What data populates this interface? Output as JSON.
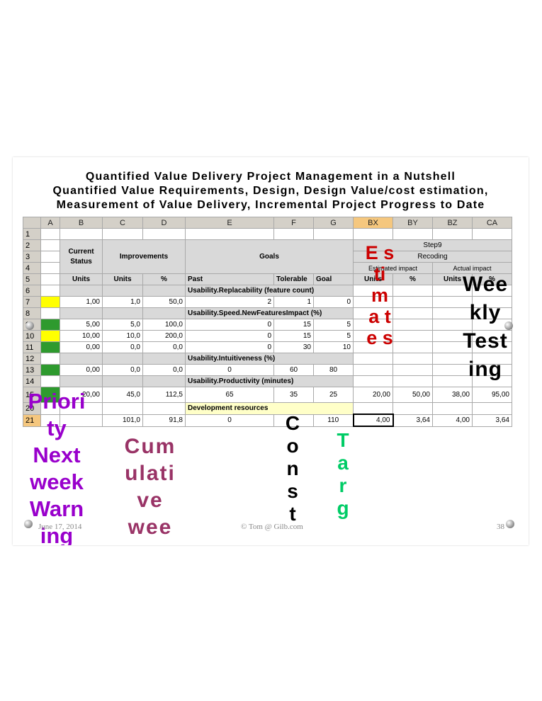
{
  "title": {
    "line1": "Quantified Value Delivery Project Management in a Nutshell",
    "line2": "Quantified Value Requirements, Design, Design Value/cost estimation,",
    "line3": "Measurement of Value Delivery, Incremental Project Progress to Date"
  },
  "sheet": {
    "columns": [
      "",
      "A",
      "B",
      "C",
      "D",
      "E",
      "F",
      "G",
      "BX",
      "BY",
      "BZ",
      "CA"
    ],
    "header_block": {
      "current_status": "Current Status",
      "improvements": "Improvements",
      "goals": "Goals",
      "step": "Step9",
      "recoding": "Recoding",
      "estimated_impact": "Estimated impact",
      "actual_impact": "Actual impact"
    },
    "units_row": [
      "Units",
      "Units",
      "%",
      "Past",
      "Tolerable",
      "Goal",
      "Units",
      "%",
      "Units",
      "%"
    ],
    "rows": [
      {
        "n": "6",
        "label": "Usability.Replacability (feature count)"
      },
      {
        "n": "7",
        "B": "1,00",
        "C": "1,0",
        "D": "50,0",
        "E": "2",
        "F": "1",
        "G": "0"
      },
      {
        "n": "8",
        "label": "Usability.Speed.NewFeaturesImpact (%)"
      },
      {
        "n": "9",
        "B": "5,00",
        "C": "5,0",
        "D": "100,0",
        "E": "0",
        "F": "15",
        "G": "5"
      },
      {
        "n": "10",
        "B": "10,00",
        "C": "10,0",
        "D": "200,0",
        "E": "0",
        "F": "15",
        "G": "5"
      },
      {
        "n": "11",
        "B": "0,00",
        "C": "0,0",
        "D": "0,0",
        "E": "0",
        "F": "30",
        "G": "10"
      },
      {
        "n": "12",
        "label": "Usability.Intuitiveness (%)"
      },
      {
        "n": "13",
        "B": "0,00",
        "C": "0,0",
        "D": "0,0",
        "E": "0",
        "F": "60",
        "G": "80"
      },
      {
        "n": "14",
        "label": "Usability.Productivity (minutes)"
      },
      {
        "n": "15",
        "B": "20,00",
        "C": "45,0",
        "D": "112,5",
        "E": "65",
        "F": "35",
        "G": "25",
        "BX": "20,00",
        "BY": "50,00",
        "BZ": "38,00",
        "CA": "95,00"
      },
      {
        "n": "20",
        "label": "Development resources"
      },
      {
        "n": "21",
        "C": "101,0",
        "D": "91,8",
        "E": "0",
        "G": "110",
        "BX": "4,00",
        "BY": "3,64",
        "BZ": "4,00",
        "CA": "3,64"
      }
    ]
  },
  "overlays": {
    "estimates": "E s ti m a t e s",
    "weekly_testing": "Wee kly Test ing",
    "priority": "Priori ty Next week Warn ing",
    "cumulative": "Cum ulati ve wee",
    "const": "C o n s t",
    "targ": "T a r g"
  },
  "footer": {
    "date": "June 17, 2014",
    "author": "© Tom @ Gilb.com",
    "page": "38"
  },
  "colors": {
    "estimates": "#cc0000",
    "priority": "#9900cc",
    "cumulative": "#993366",
    "targ": "#00cc66",
    "weekly": "#000000"
  }
}
